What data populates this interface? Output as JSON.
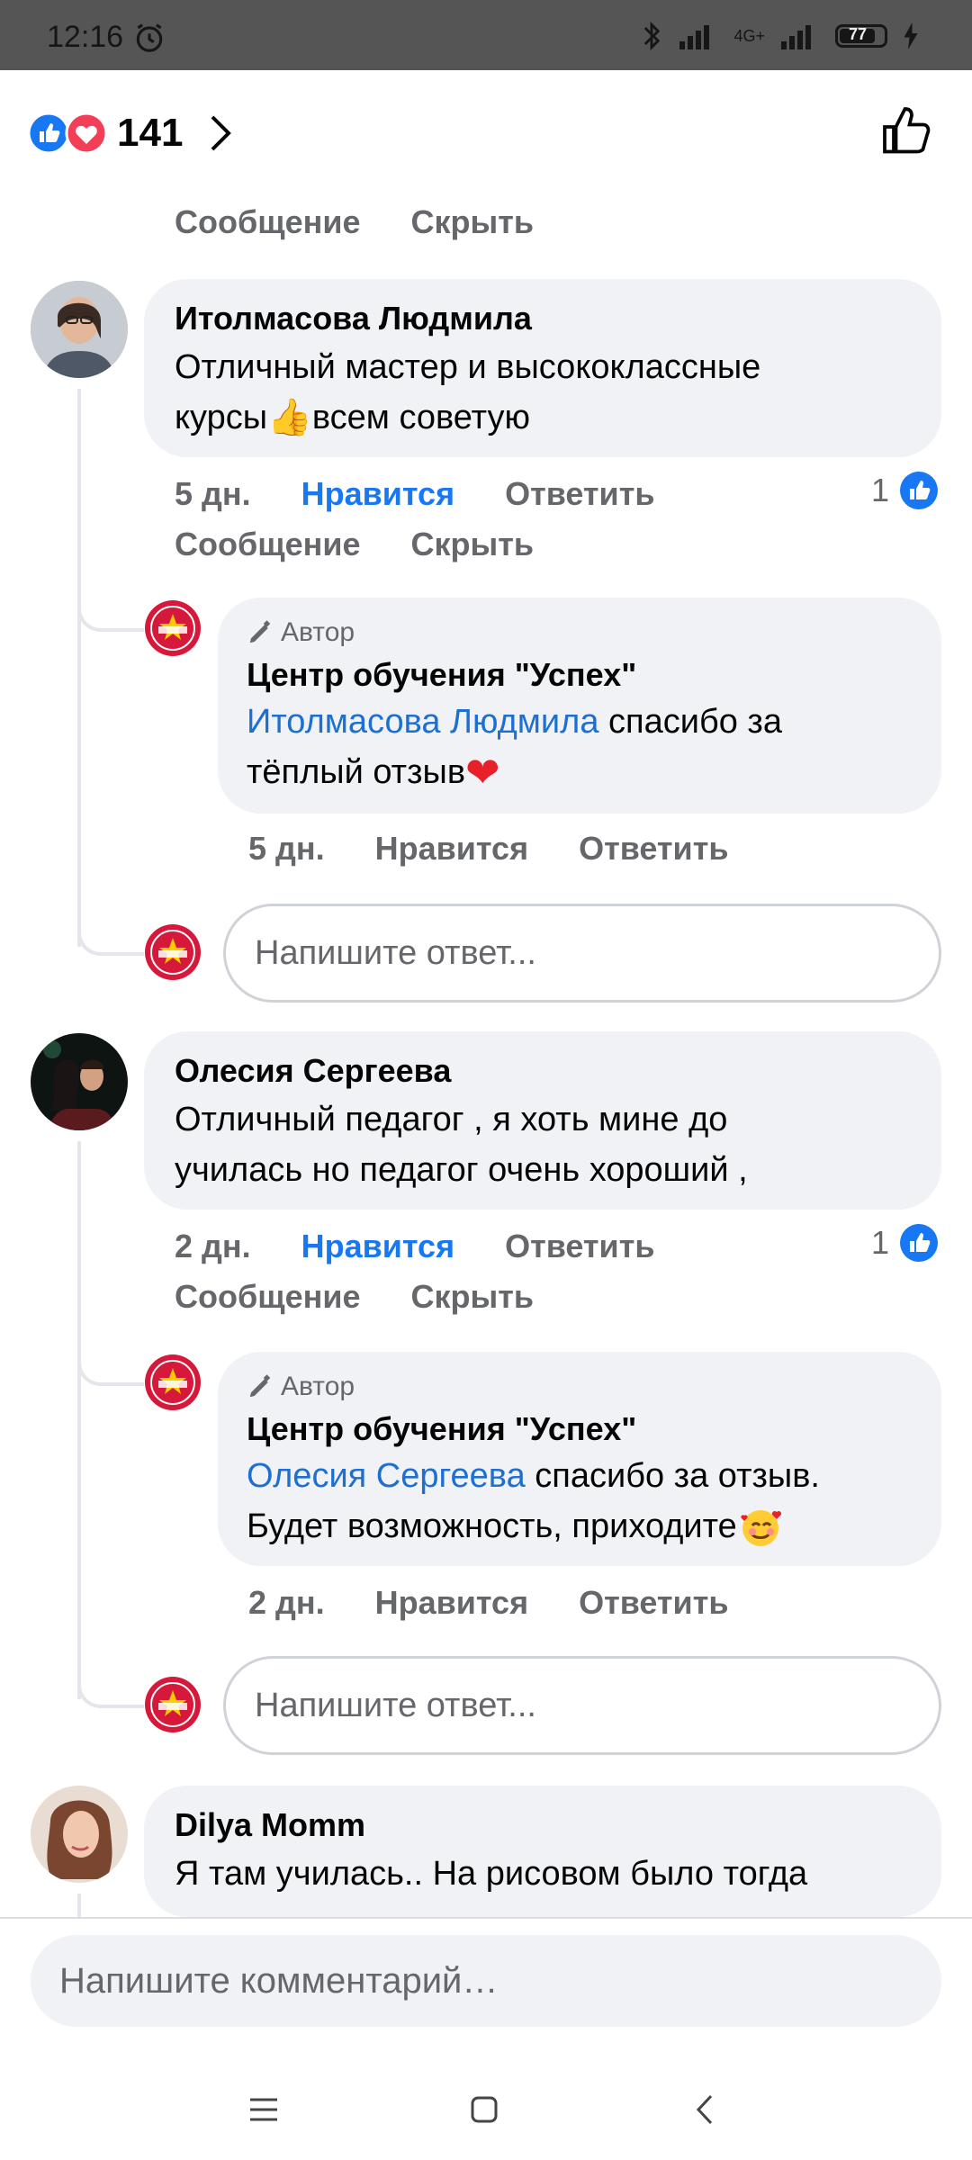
{
  "status_bar": {
    "time": "12:16",
    "network": "4G+",
    "battery": "77"
  },
  "header": {
    "reaction_count": "141"
  },
  "top_actions": {
    "message": "Сообщение",
    "hide": "Скрыть"
  },
  "comments": [
    {
      "name": "Итолмасова Людмила",
      "text_line1": "Отличный мастер и высококлассные",
      "text_line2": "курсы",
      "text_line2_rest": "всем советую",
      "time": "5 дн.",
      "like": "Нравится",
      "reply": "Ответить",
      "message": "Сообщение",
      "hide": "Скрыть",
      "reactions": "1",
      "reply_item": {
        "tag": "Автор",
        "name": "Центр обучения \"Успех\"",
        "mention": "Итолмасова Людмила",
        "text_after_mention": " спасибо за",
        "text_line2": "тёплый отзыв ",
        "time": "5 дн.",
        "like": "Нравится",
        "reply": "Ответить"
      },
      "reply_placeholder": "Напишите ответ..."
    },
    {
      "name": "Олесия Сергеева",
      "text_line1": "Отличный педагог , я хоть мине до",
      "text_line2": "училась но педагог очень хороший ,",
      "time": "2 дн.",
      "like": "Нравится",
      "reply": "Ответить",
      "message": "Сообщение",
      "hide": "Скрыть",
      "reactions": "1",
      "reply_item": {
        "tag": "Автор",
        "name": "Центр обучения \"Успех\"",
        "mention": "Олесия Сергеева",
        "text_after_mention": " спасибо за отзыв.",
        "text_line2": "Будет возможность, приходите ",
        "time": "2 дн.",
        "like": "Нравится",
        "reply": "Ответить"
      },
      "reply_placeholder": "Напишите ответ..."
    },
    {
      "name": "Dilya Momm",
      "text_line1": "Я там училась.. На рисовом было тогда"
    }
  ],
  "footer": {
    "comment_placeholder": "Напишите комментарий…"
  },
  "colors": {
    "facebook_blue": "#1877f2",
    "heart_red": "#f33e58",
    "link_blue": "#1d6fd1",
    "bubble": "#f0f2f5"
  }
}
